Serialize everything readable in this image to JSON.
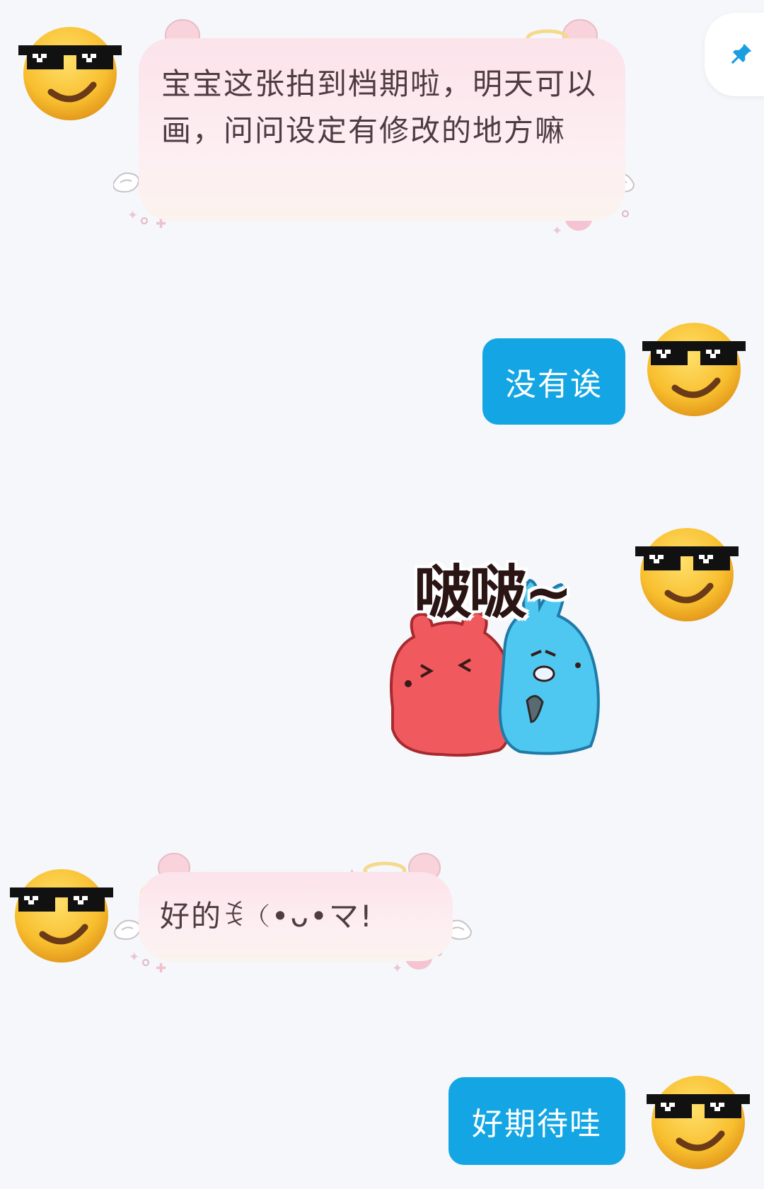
{
  "messages": [
    {
      "side": "left",
      "type": "text",
      "text": "宝宝这张拍到档期啦，明天可以画，问问设定有修改的地方嘛"
    },
    {
      "side": "right",
      "type": "text",
      "text": "没有诶"
    },
    {
      "side": "right",
      "type": "sticker",
      "text": "啵啵~"
    },
    {
      "side": "left",
      "type": "text",
      "text": "好的ꉂ（•ᴗ•マ!"
    },
    {
      "side": "right",
      "type": "text",
      "text": "好期待哇"
    }
  ],
  "icons": {
    "pin": "pin-icon",
    "avatar": "sunglasses-emoji-avatar"
  },
  "colors": {
    "background": "#f5f7fa",
    "self_bubble": "#14a6e4",
    "other_bubble": "#fbe3ea",
    "pin": "#1a9ee0"
  }
}
